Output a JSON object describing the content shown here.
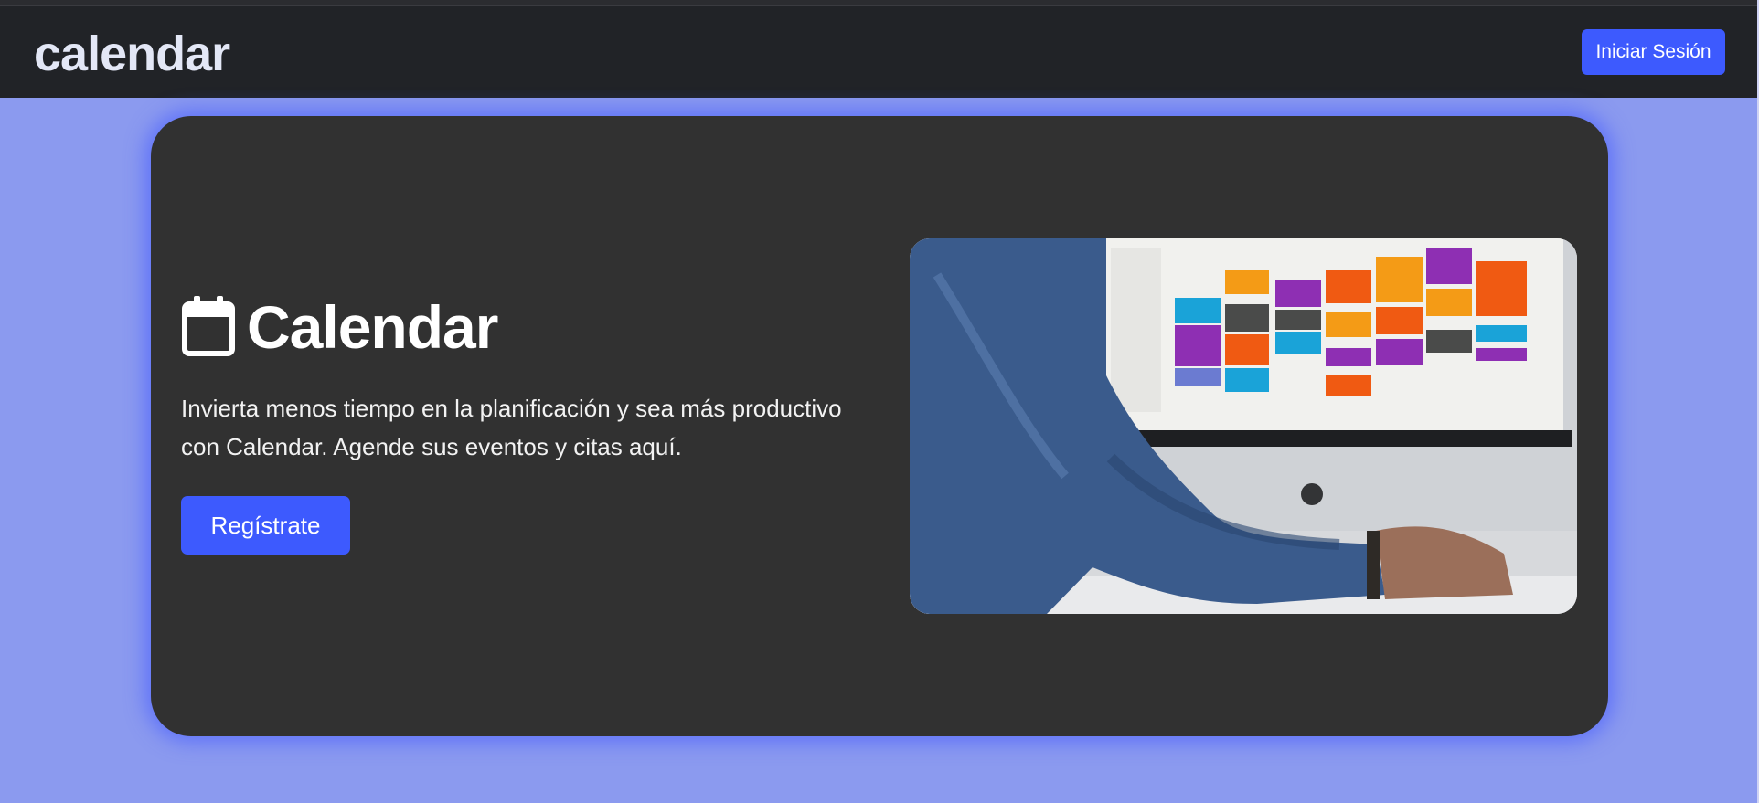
{
  "navbar": {
    "brand": "calendar",
    "login_label": "Iniciar Sesión"
  },
  "hero": {
    "title": "Calendar",
    "title_icon": "calendar-icon",
    "description": "Invierta menos tiempo en la planificación y sea más productivo con Calendar. Agende sus eventos y citas aquí.",
    "register_label": "Regístrate",
    "image": "photo of a person in a denim shirt using a computer showing a colorful calendar"
  },
  "colors": {
    "page_background": "#8b9aef",
    "navbar_background": "#212327",
    "card_background": "#313131",
    "accent": "#3d5afe",
    "card_glow": "#465cff"
  }
}
